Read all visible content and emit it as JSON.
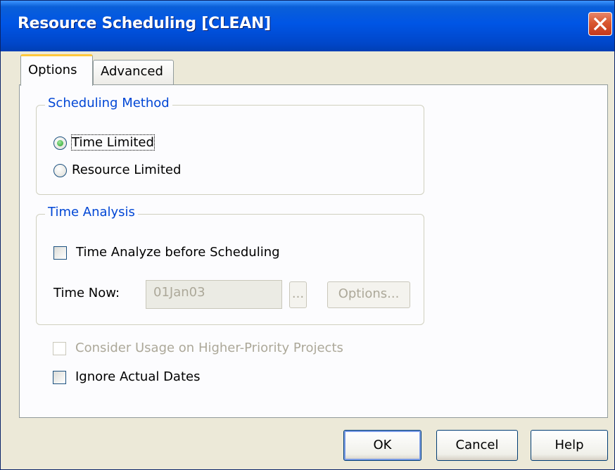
{
  "window": {
    "title": "Resource Scheduling [CLEAN]"
  },
  "tabs": [
    {
      "label": "Options",
      "active": true
    },
    {
      "label": "Advanced",
      "active": false
    }
  ],
  "scheduling_method": {
    "legend": "Scheduling Method",
    "options": [
      {
        "label": "Time Limited",
        "selected": true
      },
      {
        "label": "Resource Limited",
        "selected": false
      }
    ]
  },
  "time_analysis": {
    "legend": "Time Analysis",
    "analyze_checkbox": {
      "label": "Time Analyze before Scheduling",
      "checked": false
    },
    "time_now": {
      "label": "Time Now:",
      "value": "01Jan03",
      "browse_label": "...",
      "options_label": "Options..."
    }
  },
  "consider_usage": {
    "label": "Consider Usage on Higher-Priority Projects",
    "checked": false,
    "enabled": false
  },
  "ignore_actual": {
    "label": "Ignore Actual Dates",
    "checked": false
  },
  "buttons": {
    "ok": "OK",
    "cancel": "Cancel",
    "help": "Help"
  },
  "colors": {
    "titlebar": "#0055e5",
    "groupbox_legend": "#0046d5",
    "dialog_bg": "#ece9d8",
    "close_button": "#d9572f"
  }
}
